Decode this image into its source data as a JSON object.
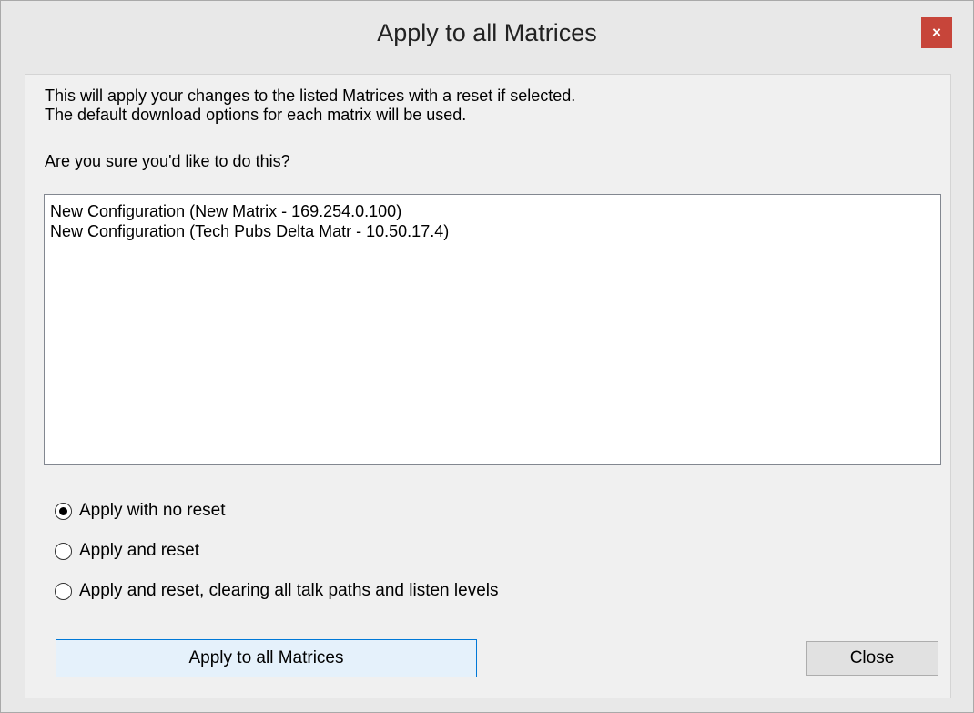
{
  "window": {
    "title": "Apply to all Matrices",
    "close_glyph": "×"
  },
  "message": {
    "line1": "This will apply your changes to the listed Matrices with a reset if selected.",
    "line2": "The default download options for each matrix will be used.",
    "question": "Are you sure you'd like to do this?"
  },
  "matrices": [
    "New Configuration (New Matrix - 169.254.0.100)",
    "New Configuration (Tech Pubs Delta Matr - 10.50.17.4)"
  ],
  "options": [
    {
      "label": "Apply with no reset",
      "selected": true
    },
    {
      "label": "Apply and reset",
      "selected": false
    },
    {
      "label": "Apply and reset, clearing all talk paths and listen levels",
      "selected": false
    }
  ],
  "buttons": {
    "apply_label": "Apply to all Matrices",
    "close_label": "Close"
  },
  "colors": {
    "close_button": "#c7453a",
    "focused_border": "#0078d7"
  }
}
